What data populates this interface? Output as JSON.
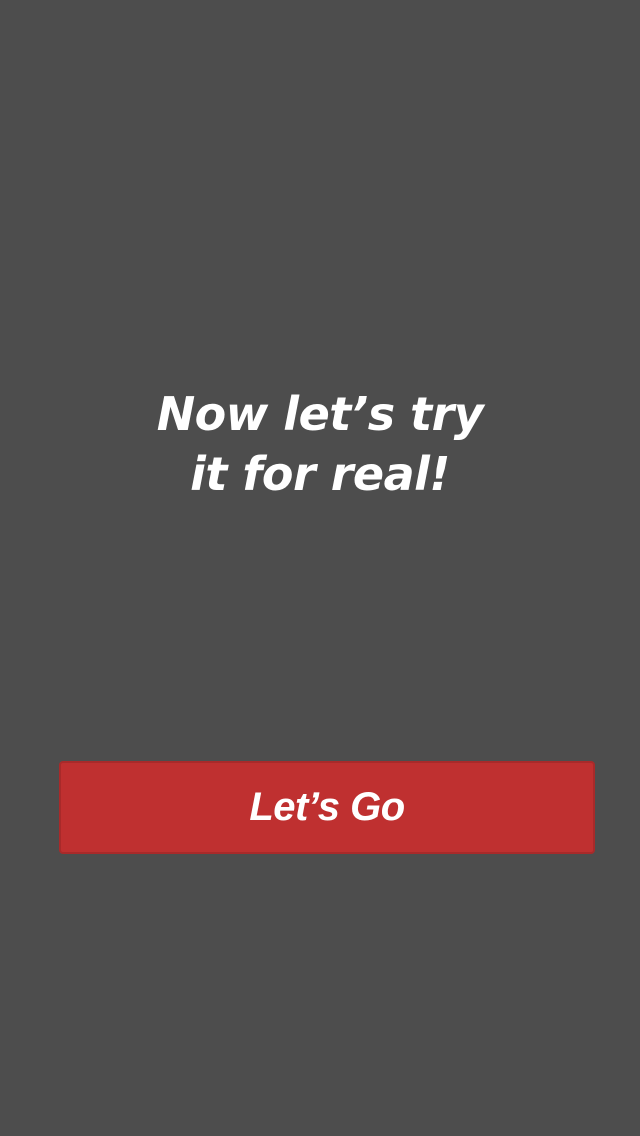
{
  "intro": {
    "headline_line1": "Now let’s try",
    "headline_line2": "it for real!"
  },
  "actions": {
    "go_label": "Let’s Go"
  },
  "colors": {
    "background": "#4d4d4d",
    "button": "#bf3030",
    "text": "#ffffff"
  }
}
